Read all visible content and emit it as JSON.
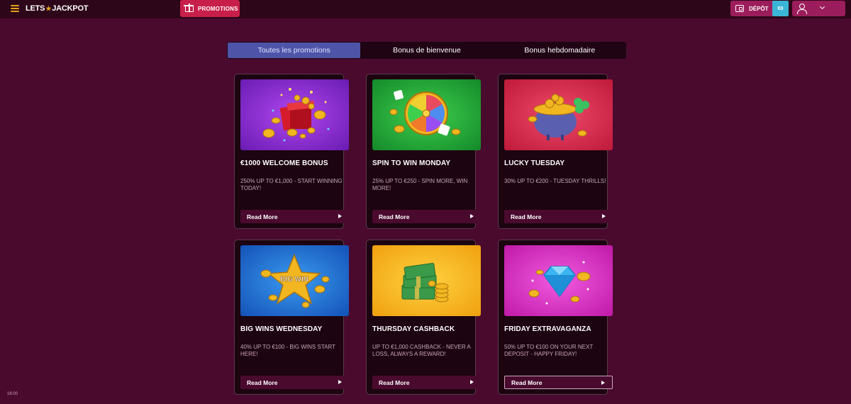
{
  "header": {
    "logo_left": "LETS",
    "logo_right": "JACKPOT",
    "promotions_label": "PROMOTIONS",
    "deposit_label": "DÉPÔT",
    "balance": "€0"
  },
  "tabs": [
    {
      "label": "Toutes les promotions"
    },
    {
      "label": "Bonus de bienvenue"
    },
    {
      "label": "Bonus hebdomadaire"
    }
  ],
  "cards": [
    {
      "title": "€1000 WELCOME BONUS",
      "desc": "250% UP TO €1,000 - START WINNING TODAY!",
      "button": "Read More"
    },
    {
      "title": "SPIN TO WIN MONDAY",
      "desc": "25% UP TO €250 - SPIN MORE, WIN MORE!",
      "button": "Read More"
    },
    {
      "title": "LUCKY TUESDAY",
      "desc": "30% UP TO €200 - TUESDAY THRILLS!",
      "button": "Read More"
    },
    {
      "title": "BIG WINS WEDNESDAY",
      "desc": "40% UP TO €100 - BIG WINS START HERE!",
      "button": "Read More",
      "img_text": "BIG WIN"
    },
    {
      "title": "THURSDAY CASHBACK",
      "desc": "UP TO €1,000 CASHBACK - NEVER A LOSS, ALWAYS A REWARD!",
      "button": "Read More"
    },
    {
      "title": "FRIDAY EXTRAVAGANZA",
      "desc": "50% UP TO €100 ON YOUR NEXT DEPOSIT - HAPPY FRIDAY!",
      "button": "Read More"
    }
  ],
  "clock": "16:00",
  "colors": {
    "background": "#4a0a2e",
    "topbar": "#2e0619",
    "promo_button": "#c81f4a",
    "active_tab": "#4e55a8",
    "balance": "#3ab5d6"
  }
}
